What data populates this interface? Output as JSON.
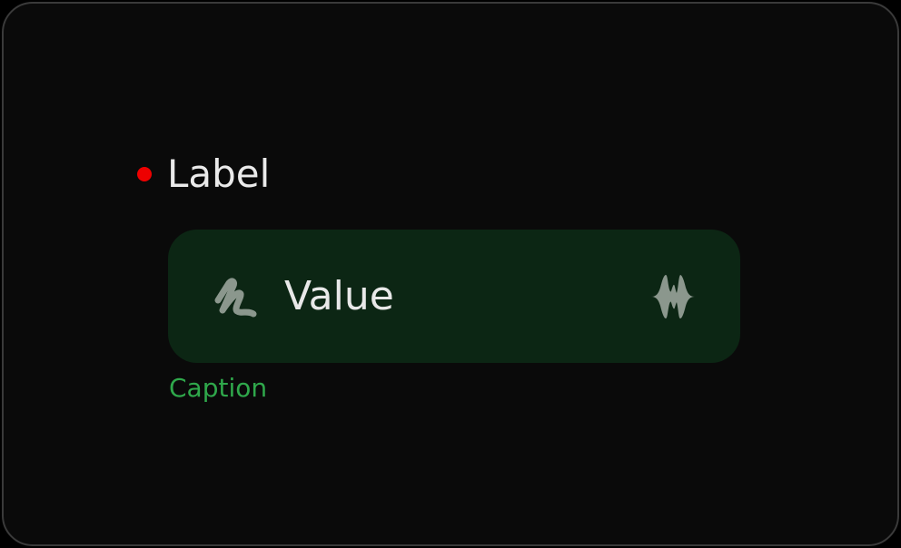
{
  "field": {
    "label": "Label",
    "required": true,
    "value": "Value",
    "caption": "Caption",
    "leading_icon": "signature-icon",
    "trailing_icon": "waveform-icon"
  },
  "colors": {
    "background": "#0a0a0a",
    "field_background": "#0c2614",
    "required_dot": "#ee0000",
    "caption": "#2fa84b",
    "icon": "#8b978d"
  }
}
